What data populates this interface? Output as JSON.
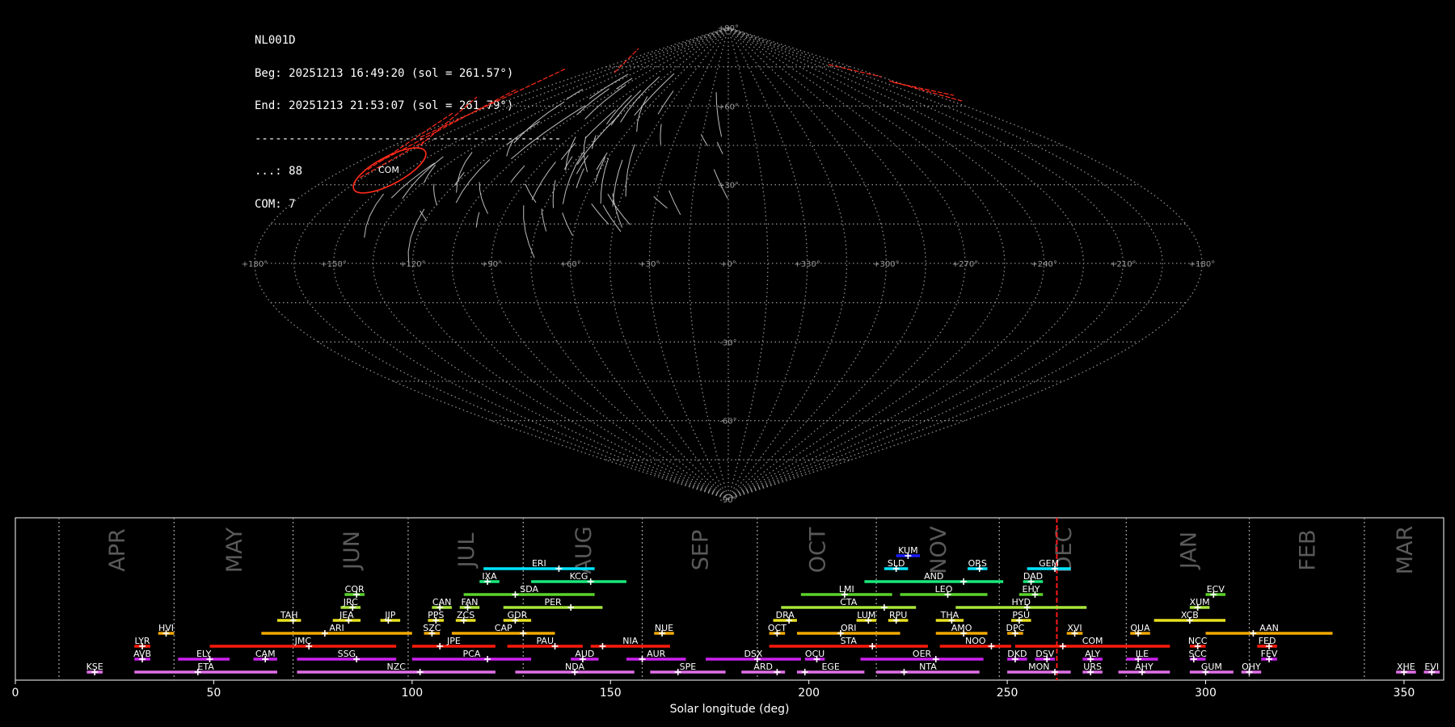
{
  "info": {
    "station": "NL001D",
    "begin": "Beg: 20251213 16:49:20 (sol = 261.57°)",
    "end": "End: 20251213 21:53:07 (sol = 261.79°)",
    "separator": "---------------------------------------------",
    "sporadic": "...: 88",
    "com": "COM: 7"
  },
  "sky_map": {
    "projection": "sinusoidal",
    "grid_color": "#8c8c8c",
    "highlight_color": "#ff2a1a",
    "lat_labels": [
      "+90°",
      "+60°",
      "+30°",
      "-30°",
      "-60°",
      "-90°"
    ],
    "lon_labels": [
      "+180°",
      "+150°",
      "+120°",
      "+90°",
      "+60°",
      "+30°",
      "+0°",
      "+330°",
      "+300°",
      "+270°",
      "+240°",
      "+210°",
      "+180°"
    ],
    "radiant_label": "COM"
  },
  "chart_data": {
    "type": "timeline",
    "xlabel": "Solar longitude (deg)",
    "xlim": [
      0,
      360
    ],
    "xticks": [
      0,
      50,
      100,
      150,
      200,
      250,
      300,
      350
    ],
    "current_sol": 262.5,
    "months": [
      {
        "name": "APR",
        "sep": 11
      },
      {
        "name": "MAY",
        "sep": 40
      },
      {
        "name": "JUN",
        "sep": 70
      },
      {
        "name": "JUL",
        "sep": 99
      },
      {
        "name": "AUG",
        "sep": 128
      },
      {
        "name": "SEP",
        "sep": 158
      },
      {
        "name": "OCT",
        "sep": 187
      },
      {
        "name": "NOV",
        "sep": 217
      },
      {
        "name": "DEC",
        "sep": 248
      },
      {
        "name": "JAN",
        "sep": 280
      },
      {
        "name": "FEB",
        "sep": 311
      },
      {
        "name": "MAR",
        "sep": 340
      }
    ],
    "showers": [
      {
        "code": "KUM",
        "start": 222,
        "end": 228,
        "peak": 225,
        "row": 9,
        "color": "#1a1aff"
      },
      {
        "code": "ERI",
        "start": 118,
        "end": 146,
        "peak": 137,
        "row": 8,
        "color": "#00e5ff"
      },
      {
        "code": "SLD",
        "start": 219,
        "end": 225,
        "peak": 222,
        "row": 8,
        "color": "#00e5ff"
      },
      {
        "code": "ORS",
        "start": 240,
        "end": 245,
        "peak": 243,
        "row": 8,
        "color": "#00e5ff"
      },
      {
        "code": "GEM",
        "start": 255,
        "end": 266,
        "peak": 262,
        "row": 8,
        "color": "#00e5ff"
      },
      {
        "code": "IXA",
        "start": 117,
        "end": 122,
        "peak": 119,
        "row": 7,
        "color": "#19e87a"
      },
      {
        "code": "KCG",
        "start": 130,
        "end": 154,
        "peak": 145,
        "row": 7,
        "color": "#19e87a"
      },
      {
        "code": "AND",
        "start": 214,
        "end": 249,
        "peak": 239,
        "row": 7,
        "color": "#19e87a"
      },
      {
        "code": "DAD",
        "start": 254,
        "end": 259,
        "peak": 256,
        "row": 7,
        "color": "#19e87a"
      },
      {
        "code": "COR",
        "start": 83,
        "end": 88,
        "peak": 86,
        "row": 6,
        "color": "#5ad42a"
      },
      {
        "code": "SDA",
        "start": 113,
        "end": 146,
        "peak": 126,
        "row": 6,
        "color": "#5ad42a"
      },
      {
        "code": "LMI",
        "start": 198,
        "end": 221,
        "peak": 209,
        "row": 6,
        "color": "#5ad42a"
      },
      {
        "code": "LEO",
        "start": 223,
        "end": 245,
        "peak": 235,
        "row": 6,
        "color": "#5ad42a"
      },
      {
        "code": "EHY",
        "start": 253,
        "end": 259,
        "peak": 257,
        "row": 6,
        "color": "#5ad42a"
      },
      {
        "code": "ECV",
        "start": 300,
        "end": 305,
        "peak": 302,
        "row": 6,
        "color": "#5ad42a"
      },
      {
        "code": "JRC",
        "start": 82,
        "end": 87,
        "peak": 85,
        "row": 5,
        "color": "#a8e63a"
      },
      {
        "code": "CAN",
        "start": 105,
        "end": 110,
        "peak": 107,
        "row": 5,
        "color": "#a8e63a"
      },
      {
        "code": "FAN",
        "start": 112,
        "end": 117,
        "peak": 114,
        "row": 5,
        "color": "#a8e63a"
      },
      {
        "code": "PER",
        "start": 123,
        "end": 148,
        "peak": 140,
        "row": 5,
        "color": "#a8e63a"
      },
      {
        "code": "CTA",
        "start": 193,
        "end": 227,
        "peak": 219,
        "row": 5,
        "color": "#a8e63a"
      },
      {
        "code": "HYD",
        "start": 237,
        "end": 270,
        "peak": 255,
        "row": 5,
        "color": "#a8e63a"
      },
      {
        "code": "XUM",
        "start": 296,
        "end": 301,
        "peak": 298,
        "row": 5,
        "color": "#a8e63a"
      },
      {
        "code": "TAH",
        "start": 66,
        "end": 72,
        "peak": 70,
        "row": 4,
        "color": "#e8e020"
      },
      {
        "code": "JEA",
        "start": 80,
        "end": 87,
        "peak": 84,
        "row": 4,
        "color": "#e8e020"
      },
      {
        "code": "JIP",
        "start": 92,
        "end": 97,
        "peak": 94,
        "row": 4,
        "color": "#e8e020"
      },
      {
        "code": "PPS",
        "start": 104,
        "end": 108,
        "peak": 106,
        "row": 4,
        "color": "#e8e020"
      },
      {
        "code": "ZCS",
        "start": 111,
        "end": 116,
        "peak": 113,
        "row": 4,
        "color": "#e8e020"
      },
      {
        "code": "GDR",
        "start": 123,
        "end": 130,
        "peak": 126,
        "row": 4,
        "color": "#e8e020"
      },
      {
        "code": "DRA",
        "start": 191,
        "end": 197,
        "peak": 195,
        "row": 4,
        "color": "#e8e020"
      },
      {
        "code": "LUM",
        "start": 212,
        "end": 217,
        "peak": 215,
        "row": 4,
        "color": "#e8e020"
      },
      {
        "code": "RPU",
        "start": 220,
        "end": 225,
        "peak": 222,
        "row": 4,
        "color": "#e8e020"
      },
      {
        "code": "THA",
        "start": 232,
        "end": 239,
        "peak": 236,
        "row": 4,
        "color": "#e8e020"
      },
      {
        "code": "PSU",
        "start": 251,
        "end": 256,
        "peak": 253,
        "row": 4,
        "color": "#e8e020"
      },
      {
        "code": "XCB",
        "start": 287,
        "end": 305,
        "peak": 296,
        "row": 4,
        "color": "#e8e020"
      },
      {
        "code": "HVI",
        "start": 36,
        "end": 40,
        "peak": 38,
        "row": 3,
        "color": "#f2a900"
      },
      {
        "code": "ARI",
        "start": 62,
        "end": 100,
        "peak": 78,
        "row": 3,
        "color": "#f2a900"
      },
      {
        "code": "SZC",
        "start": 103,
        "end": 107,
        "peak": 105,
        "row": 3,
        "color": "#f2a900"
      },
      {
        "code": "CAP",
        "start": 110,
        "end": 136,
        "peak": 128,
        "row": 3,
        "color": "#f2a900"
      },
      {
        "code": "NUE",
        "start": 161,
        "end": 166,
        "peak": 163,
        "row": 3,
        "color": "#f2a900"
      },
      {
        "code": "OCT",
        "start": 190,
        "end": 194,
        "peak": 192,
        "row": 3,
        "color": "#f2a900"
      },
      {
        "code": "ORI",
        "start": 197,
        "end": 223,
        "peak": 208,
        "row": 3,
        "color": "#f2a900"
      },
      {
        "code": "AMO",
        "start": 232,
        "end": 245,
        "peak": 239,
        "row": 3,
        "color": "#f2a900"
      },
      {
        "code": "DPC",
        "start": 250,
        "end": 254,
        "peak": 252,
        "row": 3,
        "color": "#f2a900"
      },
      {
        "code": "XVI",
        "start": 265,
        "end": 269,
        "peak": 267,
        "row": 3,
        "color": "#f2a900"
      },
      {
        "code": "QUA",
        "start": 281,
        "end": 286,
        "peak": 283,
        "row": 3,
        "color": "#f2a900"
      },
      {
        "code": "AAN",
        "start": 300,
        "end": 332,
        "peak": 312,
        "row": 3,
        "color": "#f2a900"
      },
      {
        "code": "LYR",
        "start": 30,
        "end": 34,
        "peak": 32,
        "row": 2,
        "color": "#ff1a0a"
      },
      {
        "code": "JMC",
        "start": 49,
        "end": 96,
        "peak": 74,
        "row": 2,
        "color": "#ff1a0a"
      },
      {
        "code": "JPE",
        "start": 100,
        "end": 121,
        "peak": 107,
        "row": 2,
        "color": "#ff1a0a"
      },
      {
        "code": "PAU",
        "start": 124,
        "end": 143,
        "peak": 136,
        "row": 2,
        "color": "#ff1a0a"
      },
      {
        "code": "NIA",
        "start": 145,
        "end": 165,
        "peak": 148,
        "row": 2,
        "color": "#ff1a0a"
      },
      {
        "code": "STA",
        "start": 190,
        "end": 230,
        "peak": 216,
        "row": 2,
        "color": "#ff1a0a"
      },
      {
        "code": "NOO",
        "start": 233,
        "end": 251,
        "peak": 246,
        "row": 2,
        "color": "#ff1a0a"
      },
      {
        "code": "COM",
        "start": 252,
        "end": 291,
        "peak": 264,
        "row": 2,
        "color": "#ff1a0a"
      },
      {
        "code": "NCC",
        "start": 296,
        "end": 300,
        "peak": 298,
        "row": 2,
        "color": "#ff1a0a"
      },
      {
        "code": "FED",
        "start": 313,
        "end": 318,
        "peak": 316,
        "row": 2,
        "color": "#ff1a0a"
      },
      {
        "code": "AVB",
        "start": 30,
        "end": 34,
        "peak": 32,
        "row": 1,
        "color": "#cc22ee"
      },
      {
        "code": "ELY",
        "start": 41,
        "end": 54,
        "peak": 49,
        "row": 1,
        "color": "#cc22ee"
      },
      {
        "code": "CAM",
        "start": 60,
        "end": 66,
        "peak": 63,
        "row": 1,
        "color": "#cc22ee"
      },
      {
        "code": "SSG",
        "start": 71,
        "end": 96,
        "peak": 86,
        "row": 1,
        "color": "#cc22ee"
      },
      {
        "code": "PCA",
        "start": 100,
        "end": 130,
        "peak": 119,
        "row": 1,
        "color": "#cc22ee"
      },
      {
        "code": "AUD",
        "start": 140,
        "end": 147,
        "peak": 143,
        "row": 1,
        "color": "#cc22ee"
      },
      {
        "code": "AUR",
        "start": 154,
        "end": 169,
        "peak": 158,
        "row": 1,
        "color": "#cc22ee"
      },
      {
        "code": "DSX",
        "start": 174,
        "end": 198,
        "peak": 187,
        "row": 1,
        "color": "#cc22ee"
      },
      {
        "code": "OCU",
        "start": 199,
        "end": 204,
        "peak": 202,
        "row": 1,
        "color": "#cc22ee"
      },
      {
        "code": "OER",
        "start": 213,
        "end": 244,
        "peak": 232,
        "row": 1,
        "color": "#cc22ee"
      },
      {
        "code": "DKD",
        "start": 250,
        "end": 255,
        "peak": 252,
        "row": 1,
        "color": "#cc22ee"
      },
      {
        "code": "DSV",
        "start": 257,
        "end": 262,
        "peak": 260,
        "row": 1,
        "color": "#cc22ee"
      },
      {
        "code": "ALY",
        "start": 269,
        "end": 274,
        "peak": 271,
        "row": 1,
        "color": "#cc22ee"
      },
      {
        "code": "ILE",
        "start": 280,
        "end": 288,
        "peak": 283,
        "row": 1,
        "color": "#cc22ee"
      },
      {
        "code": "SCC",
        "start": 296,
        "end": 300,
        "peak": 297,
        "row": 1,
        "color": "#cc22ee"
      },
      {
        "code": "FEV",
        "start": 314,
        "end": 318,
        "peak": 316,
        "row": 1,
        "color": "#cc22ee"
      },
      {
        "code": "KSE",
        "start": 18,
        "end": 22,
        "peak": 20,
        "row": 0,
        "color": "#e070e8"
      },
      {
        "code": "ETA",
        "start": 30,
        "end": 66,
        "peak": 46,
        "row": 0,
        "color": "#e070e8"
      },
      {
        "code": "NZC",
        "start": 71,
        "end": 121,
        "peak": 102,
        "row": 0,
        "color": "#e070e8"
      },
      {
        "code": "NDA",
        "start": 126,
        "end": 156,
        "peak": 141,
        "row": 0,
        "color": "#e070e8"
      },
      {
        "code": "SPE",
        "start": 160,
        "end": 179,
        "peak": 167,
        "row": 0,
        "color": "#e070e8"
      },
      {
        "code": "ARD",
        "start": 183,
        "end": 194,
        "peak": 192,
        "row": 0,
        "color": "#e070e8"
      },
      {
        "code": "EGE",
        "start": 197,
        "end": 214,
        "peak": 199,
        "row": 0,
        "color": "#e070e8"
      },
      {
        "code": "NTA",
        "start": 217,
        "end": 243,
        "peak": 224,
        "row": 0,
        "color": "#e070e8"
      },
      {
        "code": "MON",
        "start": 250,
        "end": 266,
        "peak": 262,
        "row": 0,
        "color": "#e070e8"
      },
      {
        "code": "URS",
        "start": 269,
        "end": 274,
        "peak": 271,
        "row": 0,
        "color": "#e070e8"
      },
      {
        "code": "AHY",
        "start": 278,
        "end": 291,
        "peak": 284,
        "row": 0,
        "color": "#e070e8"
      },
      {
        "code": "GUM",
        "start": 296,
        "end": 307,
        "peak": 300,
        "row": 0,
        "color": "#e070e8"
      },
      {
        "code": "OHY",
        "start": 309,
        "end": 314,
        "peak": 311,
        "row": 0,
        "color": "#e070e8"
      },
      {
        "code": "XHE",
        "start": 348,
        "end": 353,
        "peak": 350,
        "row": 0,
        "color": "#e070e8"
      },
      {
        "code": "EVI",
        "start": 355,
        "end": 359,
        "peak": 357,
        "row": 0,
        "color": "#e070e8"
      }
    ]
  }
}
